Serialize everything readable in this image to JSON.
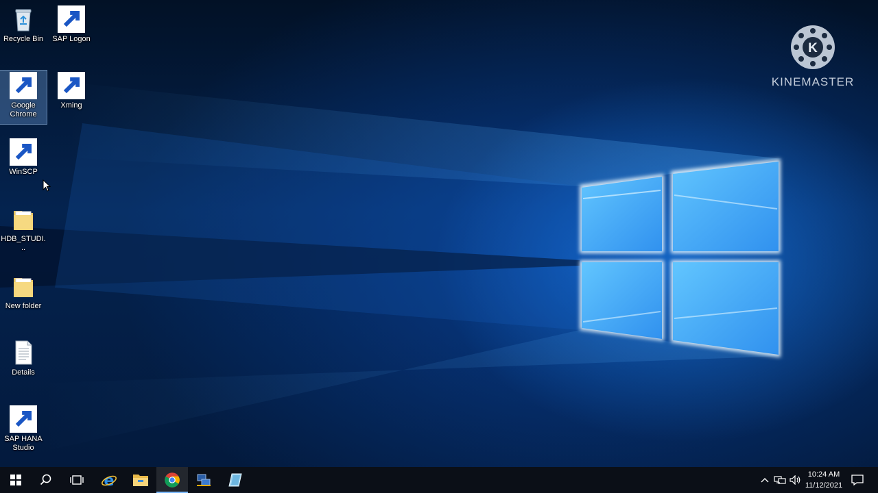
{
  "desktop": {
    "icons": [
      {
        "label": "Recycle Bin",
        "icon": "recycle-bin-icon"
      },
      {
        "label": "SAP Logon",
        "icon": "sap-logon-icon"
      },
      {
        "label": "Google Chrome",
        "icon": "chrome-icon",
        "selected": true
      },
      {
        "label": "Xming",
        "icon": "xming-icon"
      },
      {
        "label": "WinSCP",
        "icon": "winscp-icon"
      },
      {
        "label": "HDB_STUDI...",
        "icon": "folder-icon"
      },
      {
        "label": "New folder",
        "icon": "folder-icon"
      },
      {
        "label": "Details",
        "icon": "text-document-icon"
      },
      {
        "label": "SAP HANA Studio",
        "icon": "sap-hana-studio-icon"
      }
    ]
  },
  "watermark": {
    "text": "KINEMASTER",
    "logo_letter": "K"
  },
  "taskbar": {
    "buttons": [
      {
        "name": "start",
        "icon": "windows-logo-icon"
      },
      {
        "name": "search",
        "icon": "search-icon"
      },
      {
        "name": "task-view",
        "icon": "task-view-icon"
      },
      {
        "name": "internet-explorer",
        "icon": "internet-explorer-icon"
      },
      {
        "name": "file-explorer",
        "icon": "file-explorer-icon"
      },
      {
        "name": "google-chrome",
        "icon": "chrome-icon",
        "active": true
      },
      {
        "name": "sap-logon",
        "icon": "sap-logon-icon"
      },
      {
        "name": "sap-hana-studio",
        "icon": "sap-hana-studio-icon"
      }
    ],
    "tray": {
      "icons": [
        "chevron-up-icon",
        "network-icon",
        "volume-icon"
      ],
      "time": "10:24 AM",
      "date": "11/12/2021",
      "notification_icon": "action-center-icon"
    }
  },
  "colors": {
    "accent": "#0078d7",
    "taskbar": "#0b0f17",
    "active_indicator": "#7ab8ff"
  }
}
